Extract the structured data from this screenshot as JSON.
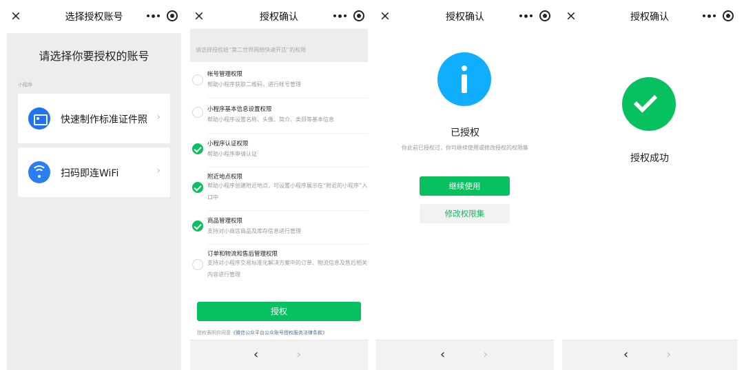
{
  "panel1": {
    "nav_title": "选择授权账号",
    "close_glyph": "×",
    "heading": "请选择你要授权的账号",
    "section_label": "小程序",
    "accounts": [
      {
        "name": "快速制作标准证件照",
        "icon": "id-card-icon",
        "arrow": "›"
      },
      {
        "name": "扫码即连WiFi",
        "icon": "wifi-icon",
        "arrow": "›"
      }
    ]
  },
  "panel2": {
    "nav_title": "授权确认",
    "close_glyph": "×",
    "banner": "请选择授权给“第二世界网络快速开店”的权限",
    "permissions": [
      {
        "title": "帐号管理权限",
        "desc": "帮助小程序获取二维码，进行帐号管理",
        "checked": false
      },
      {
        "title": "小程序基本信息设置权限",
        "desc": "帮助小程序设置名称、头像、简介、类目等基本信息",
        "checked": false
      },
      {
        "title": "小程序认证权限",
        "desc": "帮助小程序申请认证",
        "checked": true
      },
      {
        "title": "附近地点权限",
        "desc": "帮助小程序创建附近地点，可设置小程序展示在“附近的小程序”入口中",
        "checked": true
      },
      {
        "title": "商品管理权限",
        "desc": "支持对小商店商品及库存信息进行管理",
        "checked": true
      },
      {
        "title": "订单和物流和售后管理权限",
        "desc": "支持对小程序交易标准化解决方案中的订单、物流信息及售后相关内容进行管理",
        "checked": false
      }
    ],
    "button": "授权",
    "agree_prefix": "授权表明你同意",
    "agree_link": "《微信公众平台公众账号授权服务法律条款》"
  },
  "panel3": {
    "nav_title": "授权确认",
    "close_glyph": "×",
    "title": "已授权",
    "desc": "你此前已授权过，你可继续使用或修改授权的权限集",
    "primary_button": "继续使用",
    "secondary_button": "修改权限集"
  },
  "panel4": {
    "nav_title": "授权确认",
    "close_glyph": "×",
    "title": "授权成功"
  },
  "bottombar": {
    "back": "‹",
    "forward": "›"
  },
  "colors": {
    "wechat_green": "#07c160",
    "info_blue": "#10aeff",
    "link_blue": "#576b95",
    "account_icon_blue": "#1f73ef"
  }
}
